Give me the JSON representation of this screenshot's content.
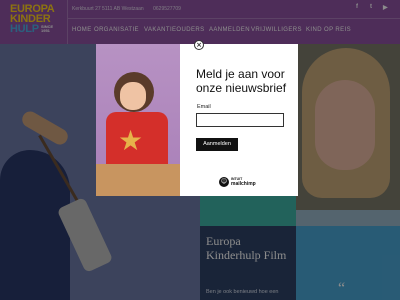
{
  "header": {
    "logo": {
      "line1": "EUROPA",
      "line2": "KINDER",
      "line3": "HULP",
      "since": "SINCE 1951"
    },
    "address": "Kerkbuurt 27 5111 AB Westzaan",
    "phone": "0629527709",
    "social": [
      "f",
      "t",
      "▶"
    ],
    "nav": [
      "HOME",
      "ORGANISATIE",
      "VAKANTIEOUDERS",
      "AANMELDEN",
      "VRIJWILLIGERS",
      "KIND OP REIS"
    ]
  },
  "modal": {
    "heading": "Meld je aan voor onze nieuwsbrief",
    "email_label": "Email",
    "email_value": "",
    "submit_label": "Aanmelden",
    "close_symbol": "×",
    "badge": {
      "line1": "INTUIT",
      "line2": "mailchimp"
    }
  },
  "background": {
    "film_title": "Europa Kinderhulp Film",
    "film_text": "Ben je ook benieuwd hoe een",
    "quote_mark": "“"
  }
}
